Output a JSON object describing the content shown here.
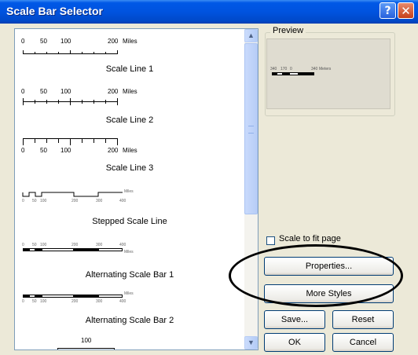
{
  "window": {
    "title": "Scale Bar Selector",
    "help_glyph": "?",
    "close_glyph": "✕"
  },
  "scrollbar": {
    "up_glyph": "▲",
    "down_glyph": "▼"
  },
  "styles": [
    {
      "name": "Scale Line 1",
      "labels": [
        "0",
        "50",
        "100",
        "200",
        "Miles"
      ]
    },
    {
      "name": "Scale Line 2",
      "labels": [
        "0",
        "50",
        "100",
        "200",
        "Miles"
      ]
    },
    {
      "name": "Scale Line 3",
      "labels": [
        "0",
        "50",
        "100",
        "200",
        "Miles"
      ]
    },
    {
      "name": "Stepped Scale Line",
      "labels": [
        "0",
        "50",
        "100",
        "200",
        "300",
        "400",
        "Miles"
      ]
    },
    {
      "name": "Alternating Scale Bar 1",
      "labels": [
        "0",
        "50",
        "100",
        "200",
        "300",
        "400",
        "Miles"
      ]
    },
    {
      "name": "Alternating Scale Bar 2",
      "labels": [
        "0",
        "50",
        "100",
        "200",
        "300",
        "400",
        "Miles"
      ]
    },
    {
      "name": "",
      "labels": [
        "100"
      ]
    }
  ],
  "preview": {
    "legend": "Preview",
    "labels": [
      "340",
      "170",
      "0",
      "340",
      "Meters"
    ]
  },
  "scale_to_fit": {
    "label": "Scale to fit page",
    "checked": false
  },
  "buttons": {
    "properties": "Properties...",
    "more_styles": "More Styles",
    "save": "Save...",
    "reset": "Reset",
    "ok": "OK",
    "cancel": "Cancel"
  },
  "colors": {
    "titlebar": "#0054e3",
    "dialog": "#ece9d8"
  }
}
